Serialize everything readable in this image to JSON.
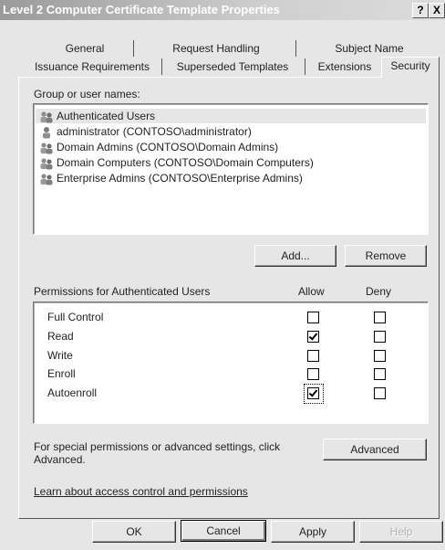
{
  "window": {
    "title": "Level 2 Computer Certificate Template Properties",
    "help_button": "?",
    "close_button": "X"
  },
  "tabs_row1": [
    "General",
    "Request Handling",
    "Subject Name"
  ],
  "tabs_row2": [
    "Issuance Requirements",
    "Superseded Templates",
    "Extensions",
    "Security"
  ],
  "active_tab": "Security",
  "security": {
    "group_label": "Group or user names:",
    "users": [
      "Authenticated Users",
      "administrator (CONTOSO\\administrator)",
      "Domain Admins (CONTOSO\\Domain Admins)",
      "Domain Computers (CONTOSO\\Domain Computers)",
      "Enterprise Admins (CONTOSO\\Enterprise Admins)"
    ],
    "add_button": "Add...",
    "remove_button": "Remove",
    "permissions_label": "Permissions for Authenticated Users",
    "allow_header": "Allow",
    "deny_header": "Deny",
    "permissions": [
      {
        "name": "Full Control",
        "allow": false,
        "deny": false
      },
      {
        "name": "Read",
        "allow": true,
        "deny": false
      },
      {
        "name": "Write",
        "allow": false,
        "deny": false
      },
      {
        "name": "Enroll",
        "allow": false,
        "deny": false
      },
      {
        "name": "Autoenroll",
        "allow": true,
        "deny": false
      }
    ],
    "special_text_line1": "For special permissions or advanced settings, click",
    "special_text_line2": "Advanced.",
    "advanced_button": "Advanced",
    "learn_link": "Learn about access control and permissions"
  },
  "footer": {
    "ok": "OK",
    "cancel": "Cancel",
    "apply": "Apply",
    "help": "Help"
  }
}
